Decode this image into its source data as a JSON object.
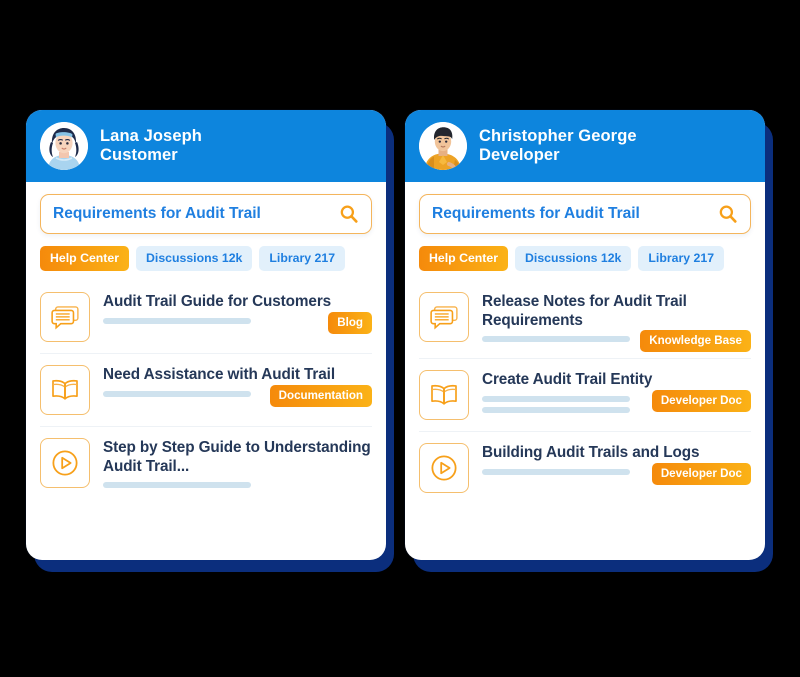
{
  "cards": [
    {
      "id": "customer-card",
      "avatar": "female-avatar-icon",
      "user_name": "Lana Joseph",
      "user_role": "Customer",
      "search": {
        "value": "Requirements for Audit Trail",
        "placeholder": "Search",
        "icon": "search-icon"
      },
      "tabs": [
        {
          "label": "Help Center",
          "active": true
        },
        {
          "label": "Discussions 12k",
          "active": false
        },
        {
          "label": "Library 217",
          "active": false
        }
      ],
      "results": [
        {
          "icon": "chat-bubbles-icon",
          "title": "Audit Trail Guide for Customers",
          "badge": "Blog",
          "bars": 1
        },
        {
          "icon": "open-book-icon",
          "title": "Need Assistance with Audit Trail",
          "badge": "Documentation",
          "bars": 1
        },
        {
          "icon": "play-circle-icon",
          "title": "Step by Step Guide to Understanding Audit Trail...",
          "badge": "",
          "bars": 1
        }
      ]
    },
    {
      "id": "developer-card",
      "avatar": "male-avatar-icon",
      "user_name": "Christopher George",
      "user_role": "Developer",
      "search": {
        "value": "Requirements for Audit Trail",
        "placeholder": "Search",
        "icon": "search-icon"
      },
      "tabs": [
        {
          "label": "Help Center",
          "active": true
        },
        {
          "label": "Discussions 12k",
          "active": false
        },
        {
          "label": "Library 217",
          "active": false
        }
      ],
      "results": [
        {
          "icon": "chat-bubbles-icon",
          "title": "Release Notes for Audit Trail Requirements",
          "badge": "Knowledge Base",
          "bars": 1
        },
        {
          "icon": "open-book-icon",
          "title": "Create Audit Trail Entity",
          "badge": "Developer Doc",
          "bars": 2
        },
        {
          "icon": "play-circle-icon",
          "title": "Building Audit Trails and Logs",
          "badge": "Developer Doc",
          "bars": 1
        }
      ]
    }
  ],
  "colors": {
    "background": "#000000",
    "card_header_blue": "#0d85dd",
    "card_shadow_navy": "#0b2e7d",
    "accent_orange": "#f58a0b",
    "accent_orange_light": "#fbb217",
    "link_blue": "#1f7fe0",
    "tab_inactive_bg": "#e2f0fb",
    "title_navy": "#253858",
    "skeleton_bar": "#cfe2ee"
  }
}
